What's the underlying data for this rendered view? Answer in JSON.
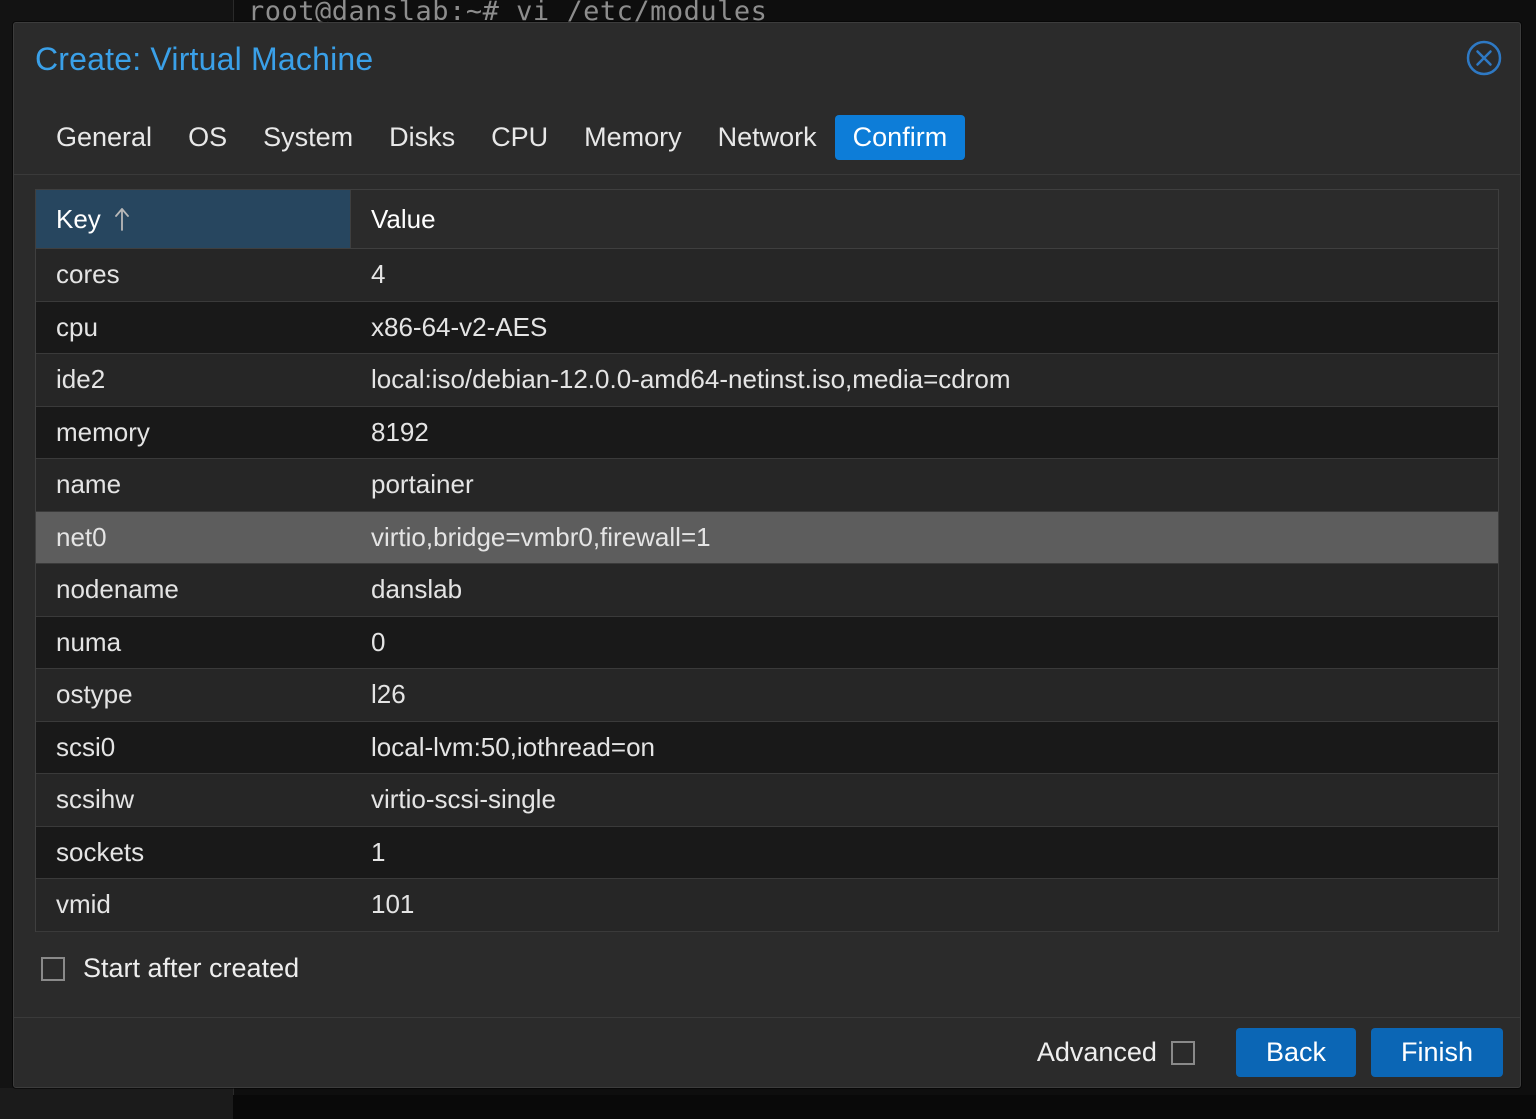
{
  "background": {
    "terminal_line": "root@danslab:~# vi /etc/modules"
  },
  "dialog": {
    "title": "Create: Virtual Machine",
    "close_icon": "close-circle-icon",
    "tabs": [
      {
        "label": "General",
        "active": false
      },
      {
        "label": "OS",
        "active": false
      },
      {
        "label": "System",
        "active": false
      },
      {
        "label": "Disks",
        "active": false
      },
      {
        "label": "CPU",
        "active": false
      },
      {
        "label": "Memory",
        "active": false
      },
      {
        "label": "Network",
        "active": false
      },
      {
        "label": "Confirm",
        "active": true
      }
    ],
    "table": {
      "columns": [
        {
          "label": "Key",
          "sorted": true,
          "sort_icon": "sort-ascending-arrow-icon"
        },
        {
          "label": "Value",
          "sorted": false
        }
      ],
      "rows": [
        {
          "key": "cores",
          "value": "4",
          "selected": false
        },
        {
          "key": "cpu",
          "value": "x86-64-v2-AES",
          "selected": false
        },
        {
          "key": "ide2",
          "value": "local:iso/debian-12.0.0-amd64-netinst.iso,media=cdrom",
          "selected": false
        },
        {
          "key": "memory",
          "value": "8192",
          "selected": false
        },
        {
          "key": "name",
          "value": "portainer",
          "selected": false
        },
        {
          "key": "net0",
          "value": "virtio,bridge=vmbr0,firewall=1",
          "selected": true
        },
        {
          "key": "nodename",
          "value": "danslab",
          "selected": false
        },
        {
          "key": "numa",
          "value": "0",
          "selected": false
        },
        {
          "key": "ostype",
          "value": "l26",
          "selected": false
        },
        {
          "key": "scsi0",
          "value": "local-lvm:50,iothread=on",
          "selected": false
        },
        {
          "key": "scsihw",
          "value": "virtio-scsi-single",
          "selected": false
        },
        {
          "key": "sockets",
          "value": "1",
          "selected": false
        },
        {
          "key": "vmid",
          "value": "101",
          "selected": false
        }
      ]
    },
    "start_after_created": {
      "label": "Start after created",
      "checked": false
    },
    "footer": {
      "advanced_label": "Advanced",
      "advanced_checked": false,
      "back_label": "Back",
      "finish_label": "Finish"
    }
  },
  "colors": {
    "accent_blue": "#0d7dd8",
    "button_blue": "#0b66b5",
    "title_blue": "#3aa0e8",
    "sorted_header": "#27465f",
    "selected_row": "#5d5d5d",
    "dialog_bg": "#2b2b2b"
  }
}
